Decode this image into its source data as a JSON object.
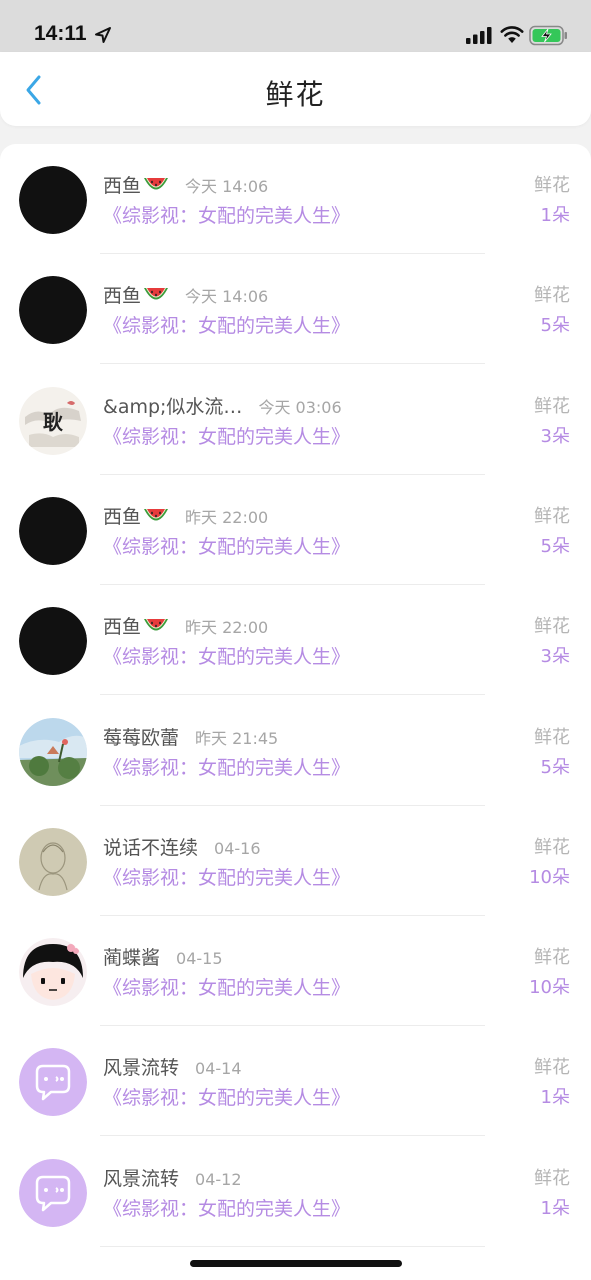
{
  "status_bar": {
    "time": "14:11"
  },
  "header": {
    "title": "鲜花"
  },
  "list": [
    {
      "name": "西鱼",
      "emoji": true,
      "time": "今天 14:06",
      "book": "《综影视：女配的完美人生》",
      "gift": "鲜花",
      "count": "1朵",
      "avatar": "black"
    },
    {
      "name": "西鱼",
      "emoji": true,
      "time": "今天 14:06",
      "book": "《综影视：女配的完美人生》",
      "gift": "鲜花",
      "count": "5朵",
      "avatar": "black"
    },
    {
      "name": "&amp;似水流…",
      "emoji": false,
      "time": "今天 03:06",
      "book": "《综影视：女配的完美人生》",
      "gift": "鲜花",
      "count": "3朵",
      "avatar": "calligraphy",
      "avatar_char": "耿"
    },
    {
      "name": "西鱼",
      "emoji": true,
      "time": "昨天 22:00",
      "book": "《综影视：女配的完美人生》",
      "gift": "鲜花",
      "count": "5朵",
      "avatar": "black"
    },
    {
      "name": "西鱼",
      "emoji": true,
      "time": "昨天 22:00",
      "book": "《综影视：女配的完美人生》",
      "gift": "鲜花",
      "count": "3朵",
      "avatar": "black"
    },
    {
      "name": "莓莓欧蕾",
      "emoji": false,
      "time": "昨天 21:45",
      "book": "《综影视：女配的完美人生》",
      "gift": "鲜花",
      "count": "5朵",
      "avatar": "landscape"
    },
    {
      "name": "说话不连续",
      "emoji": false,
      "time": "04-16",
      "book": "《综影视：女配的完美人生》",
      "gift": "鲜花",
      "count": "10朵",
      "avatar": "sketch"
    },
    {
      "name": "蔺蝶酱",
      "emoji": false,
      "time": "04-15",
      "book": "《综影视：女配的完美人生》",
      "gift": "鲜花",
      "count": "10朵",
      "avatar": "cartoon"
    },
    {
      "name": "风景流转",
      "emoji": false,
      "time": "04-14",
      "book": "《综影视：女配的完美人生》",
      "gift": "鲜花",
      "count": "1朵",
      "avatar": "default"
    },
    {
      "name": "风景流转",
      "emoji": false,
      "time": "04-12",
      "book": "《综影视：女配的完美人生》",
      "gift": "鲜花",
      "count": "1朵",
      "avatar": "default"
    }
  ],
  "colors": {
    "accent_purple": "#b58be3",
    "back_arrow_blue": "#3ba7e6",
    "avatar_default_purple": "#d4b6f3"
  }
}
